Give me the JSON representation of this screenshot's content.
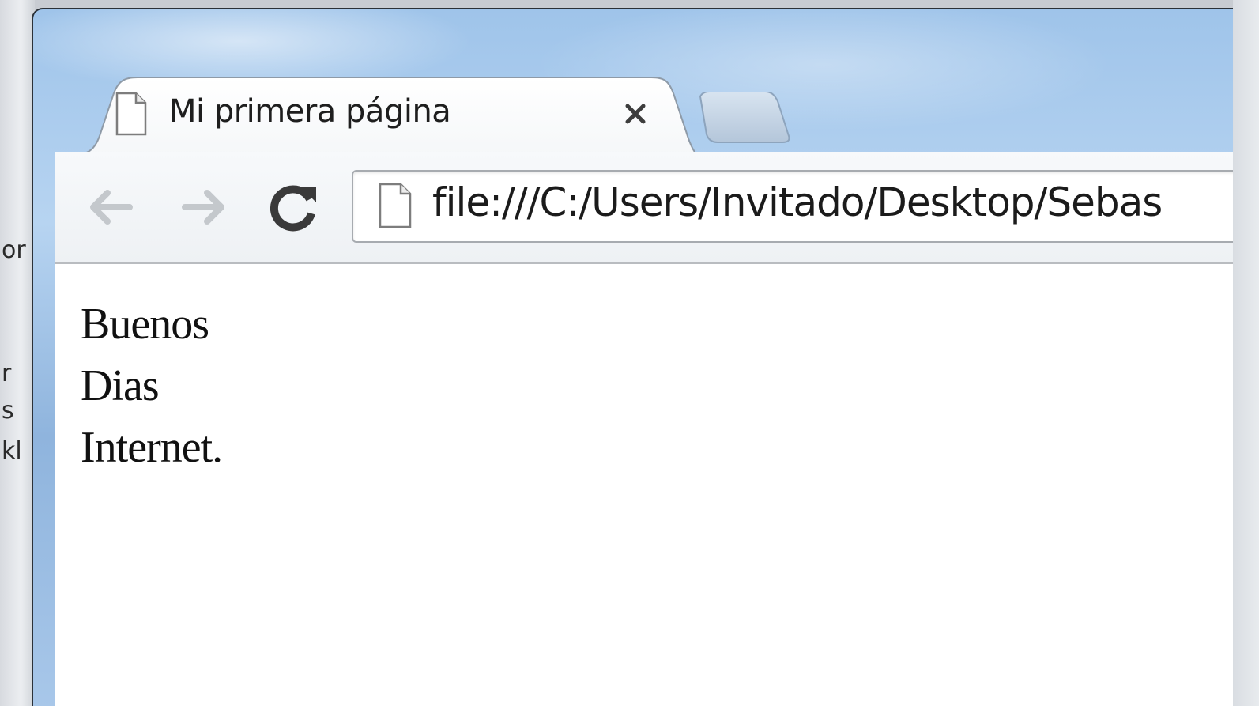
{
  "browser": {
    "tab": {
      "title": "Mi primera página",
      "icon": "page-icon",
      "close_icon": "close-icon"
    },
    "new_tab_icon": "new-tab-icon",
    "toolbar": {
      "back_icon": "back-arrow-icon",
      "forward_icon": "forward-arrow-icon",
      "reload_icon": "reload-icon",
      "url": "file:///C:/Users/Invitado/Desktop/Sebas",
      "url_icon": "page-icon"
    }
  },
  "page": {
    "lines": [
      "Buenos",
      "Dias",
      "Internet."
    ]
  },
  "desktop": {
    "glyphs": [
      "or",
      "r",
      "s",
      "kl"
    ]
  },
  "colors": {
    "frame": "#2b3138",
    "titlebar_blue": "#9fc4ea",
    "toolbar_bg": "#f7f9fb",
    "content_bg": "#ffffff",
    "text": "#111111",
    "disabled_nav": "#c4c8cc"
  }
}
